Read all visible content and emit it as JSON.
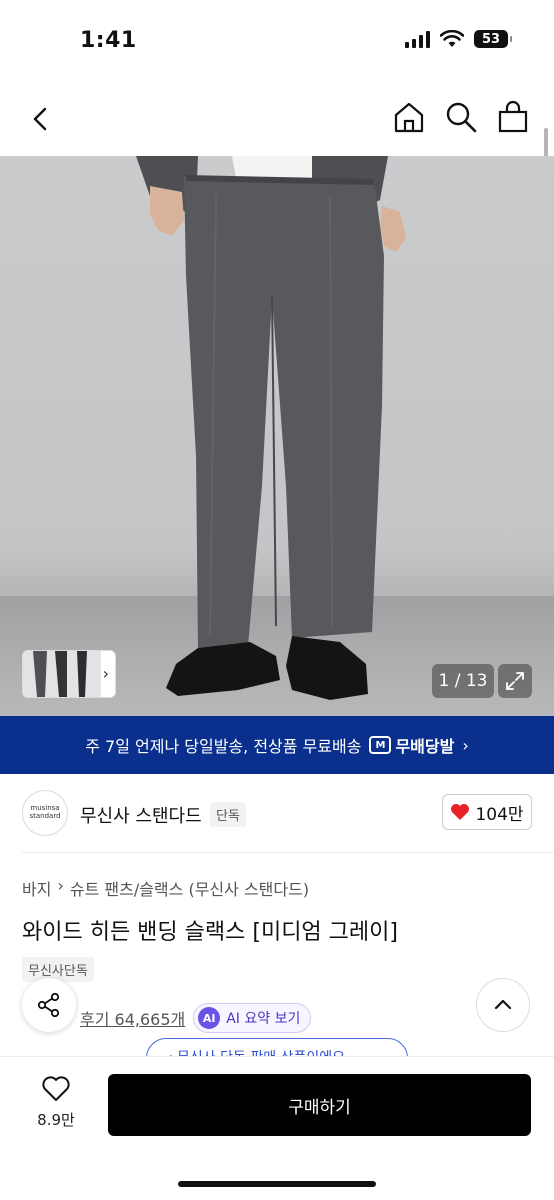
{
  "status_bar": {
    "time": "1:41",
    "battery": "53"
  },
  "nav": {
    "back_icon": "chevron-left-icon",
    "home_icon": "home-icon",
    "search_icon": "search-icon",
    "cart_icon": "shopping-bag-icon"
  },
  "gallery": {
    "counter": "1 / 13",
    "expand_icon": "expand-icon"
  },
  "promo": {
    "text": "주 7일 언제나 당일발송, 전상품 무료배송",
    "logo_mark": "M",
    "logo_text": "무배당발",
    "arrow": "›",
    "background": "#0a2f8c"
  },
  "brand": {
    "logo_line1": "musinsa",
    "logo_line2": "standard",
    "name": "무신사 스탠다드",
    "tag": "단독",
    "likes": "104만",
    "heart_color": "#e8202a"
  },
  "product": {
    "breadcrumb": [
      "바지",
      "슈트 팬츠/슬랙스 (무신사 스탠다드)"
    ],
    "breadcrumb_sep": "›",
    "title": "와이드 히든 밴딩 슬랙스 [미디엄 그레이]",
    "badge": "무신사단독",
    "reviews": "후기 64,665개",
    "ai_label": "AI",
    "ai_button": "AI 요약 보기"
  },
  "floating": {
    "peek_text": "‹ 무신사 단독 판매 상품이에요"
  },
  "bottom": {
    "wish_count": "8.9만",
    "buy_label": "구매하기"
  }
}
